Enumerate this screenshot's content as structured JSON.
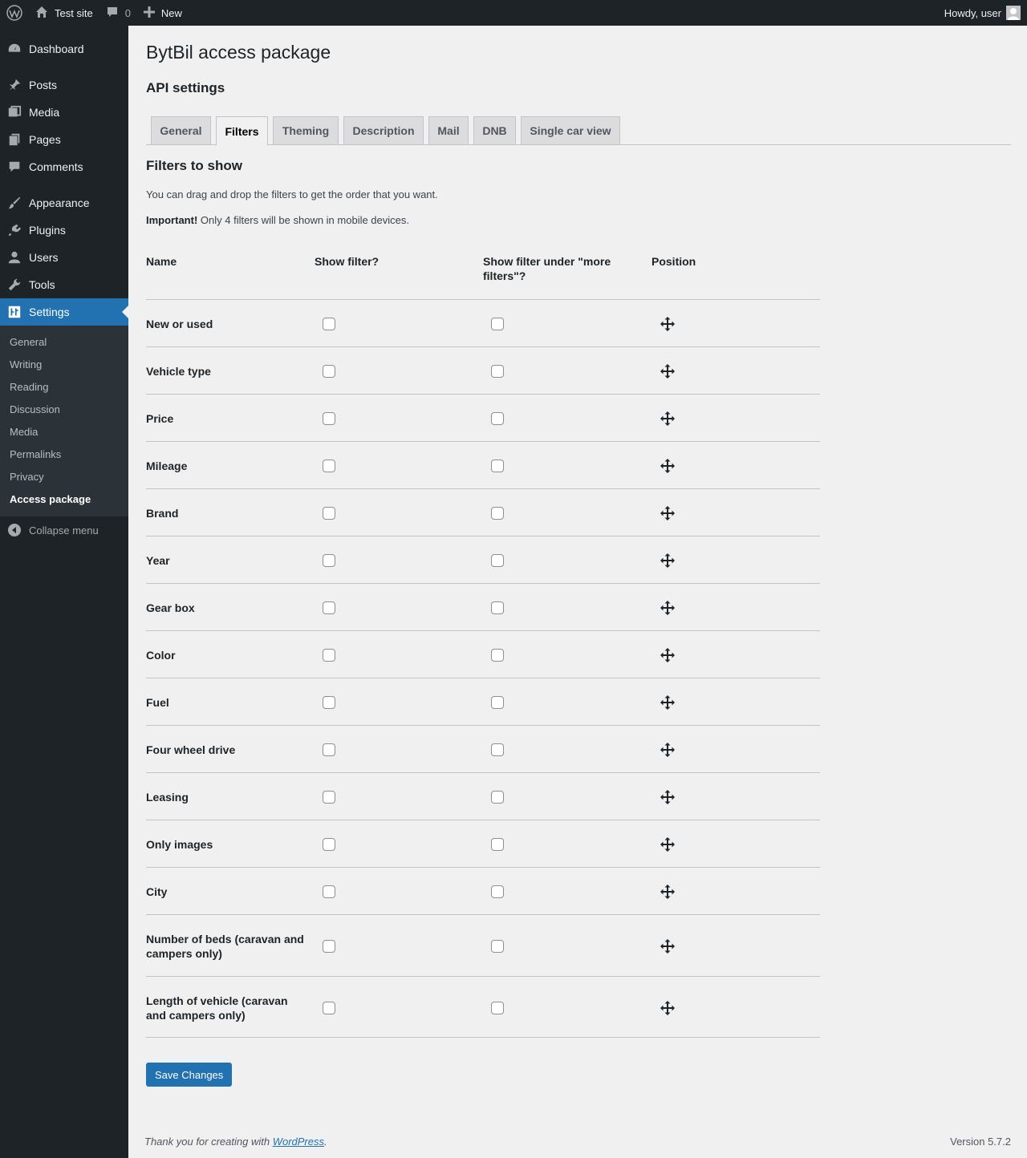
{
  "adminbar": {
    "site_name": "Test site",
    "comments_count": "0",
    "new_label": "New",
    "howdy": "Howdy, user"
  },
  "sidebar": {
    "items": [
      {
        "label": "Dashboard",
        "icon": "dashboard-icon"
      },
      {
        "label": "Posts",
        "icon": "pin-icon"
      },
      {
        "label": "Media",
        "icon": "media-icon"
      },
      {
        "label": "Pages",
        "icon": "pages-icon"
      },
      {
        "label": "Comments",
        "icon": "comment-icon"
      },
      {
        "label": "Appearance",
        "icon": "brush-icon"
      },
      {
        "label": "Plugins",
        "icon": "plugin-icon"
      },
      {
        "label": "Users",
        "icon": "user-icon"
      },
      {
        "label": "Tools",
        "icon": "wrench-icon"
      },
      {
        "label": "Settings",
        "icon": "settings-icon"
      }
    ],
    "submenu": [
      "General",
      "Writing",
      "Reading",
      "Discussion",
      "Media",
      "Permalinks",
      "Privacy",
      "Access package"
    ],
    "collapse_label": "Collapse menu"
  },
  "main": {
    "page_title": "BytBil access package",
    "section_title": "API settings",
    "tabs": [
      "General",
      "Filters",
      "Theming",
      "Description",
      "Mail",
      "DNB",
      "Single car view"
    ],
    "active_tab": "Filters",
    "filters_heading": "Filters to show",
    "help_text": "You can drag and drop the filters to get the order that you want.",
    "important_label": "Important!",
    "important_text": " Only 4 filters will be shown in mobile devices.",
    "columns": {
      "name": "Name",
      "show": "Show filter?",
      "more": "Show filter under \"more filters\"?",
      "position": "Position"
    },
    "filters": [
      {
        "name": "New or used",
        "show": false,
        "more": false
      },
      {
        "name": "Vehicle type",
        "show": false,
        "more": false
      },
      {
        "name": "Price",
        "show": false,
        "more": false
      },
      {
        "name": "Mileage",
        "show": false,
        "more": false
      },
      {
        "name": "Brand",
        "show": false,
        "more": false
      },
      {
        "name": "Year",
        "show": false,
        "more": false
      },
      {
        "name": "Gear box",
        "show": false,
        "more": false
      },
      {
        "name": "Color",
        "show": false,
        "more": false
      },
      {
        "name": "Fuel",
        "show": false,
        "more": false
      },
      {
        "name": "Four wheel drive",
        "show": false,
        "more": false
      },
      {
        "name": "Leasing",
        "show": false,
        "more": false
      },
      {
        "name": "Only images",
        "show": false,
        "more": false
      },
      {
        "name": "City",
        "show": false,
        "more": false
      },
      {
        "name": "Number of beds (caravan and campers only)",
        "show": false,
        "more": false
      },
      {
        "name": "Length of vehicle (caravan and campers only)",
        "show": false,
        "more": false
      }
    ],
    "save_label": "Save Changes"
  },
  "footer": {
    "thanks_prefix": "Thank you for creating with ",
    "thanks_link": "WordPress",
    "thanks_suffix": ".",
    "version": "Version 5.7.2"
  },
  "colors": {
    "adminbar_bg": "#1d2327",
    "accent": "#2271b1",
    "page_bg": "#f0f0f1"
  }
}
